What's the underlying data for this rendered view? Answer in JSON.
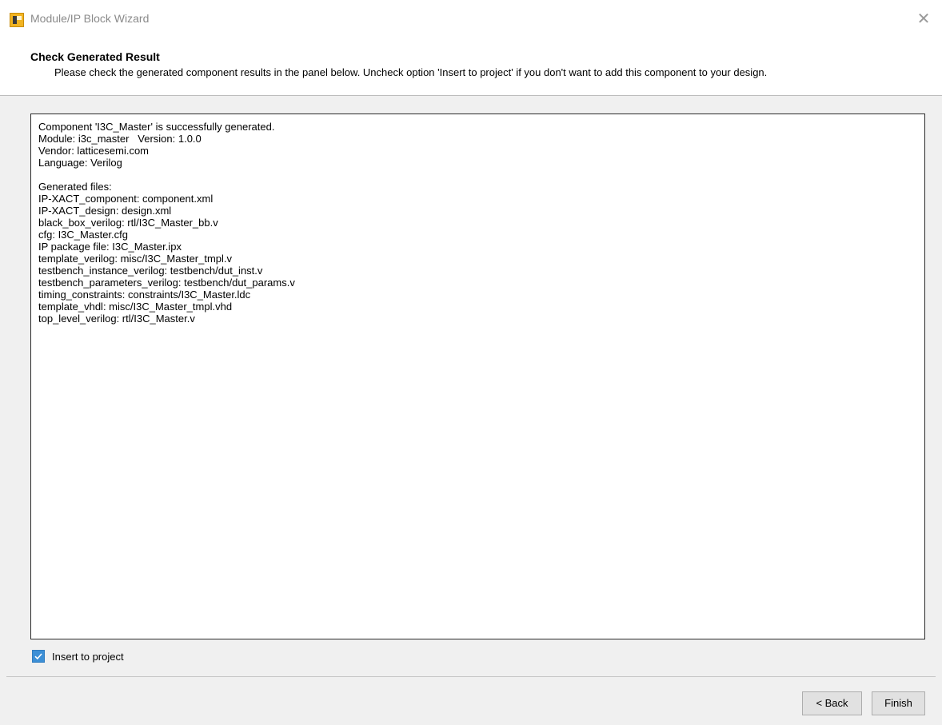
{
  "window": {
    "title": "Module/IP Block Wizard",
    "close_symbol": "✕"
  },
  "header": {
    "title": "Check Generated Result",
    "subtitle": "Please check the generated component results in the panel below. Uncheck option 'Insert to project' if you don't want to add this component to your design."
  },
  "results": {
    "lines": [
      "Component 'I3C_Master' is successfully generated.",
      "Module: i3c_master   Version: 1.0.0",
      "Vendor: latticesemi.com",
      "Language: Verilog",
      "",
      "Generated files:",
      "IP-XACT_component: component.xml",
      "IP-XACT_design: design.xml",
      "black_box_verilog: rtl/I3C_Master_bb.v",
      "cfg: I3C_Master.cfg",
      "IP package file: I3C_Master.ipx",
      "template_verilog: misc/I3C_Master_tmpl.v",
      "testbench_instance_verilog: testbench/dut_inst.v",
      "testbench_parameters_verilog: testbench/dut_params.v",
      "timing_constraints: constraints/I3C_Master.ldc",
      "template_vhdl: misc/I3C_Master_tmpl.vhd",
      "top_level_verilog: rtl/I3C_Master.v"
    ]
  },
  "insert_option": {
    "label": "Insert to project",
    "checked": true
  },
  "buttons": {
    "back_label": "< Back",
    "finish_label": "Finish"
  },
  "colors": {
    "checkbox_accent": "#3c8fd6",
    "app_icon": "#f2b422"
  },
  "icons": {
    "app": "lattice-app-icon",
    "close": "close-icon",
    "check": "checkmark-icon"
  }
}
